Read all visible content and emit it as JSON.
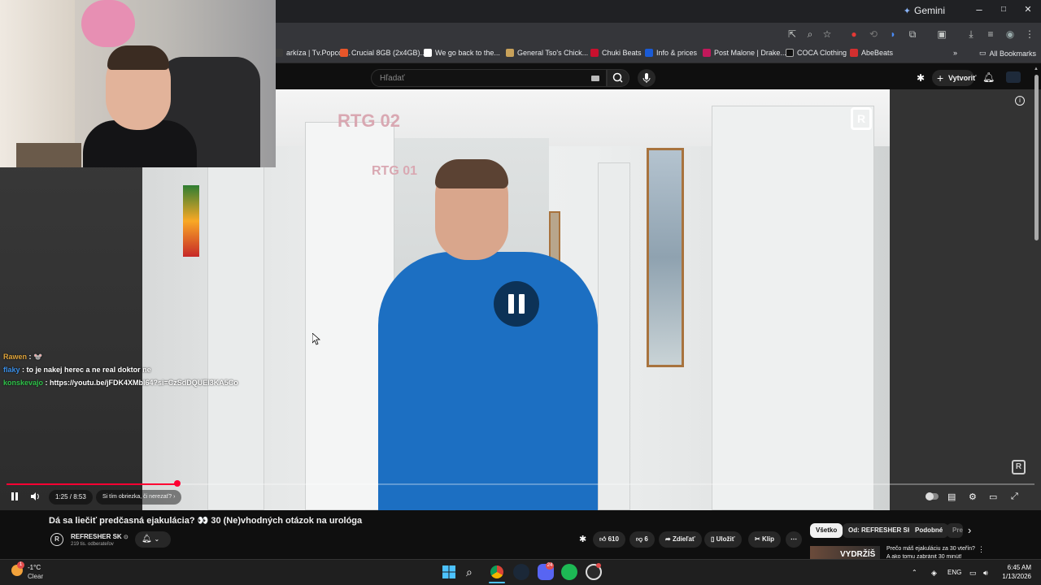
{
  "browser": {
    "gemini_label": "Gemini",
    "window_controls": [
      "–",
      "□",
      "✕"
    ],
    "bookmarks": [
      {
        "label": "arkíza | Tv.Popcor...",
        "color": "#3a3a3a"
      },
      {
        "label": "Crucial 8GB (2x4GB)...",
        "color": "#e8562a"
      },
      {
        "label": "We go back to the...",
        "color": "#ffffff"
      },
      {
        "label": "General Tso's Chick...",
        "color": "#c8a15a"
      },
      {
        "label": "Chuki Beats",
        "color": "#c8102e"
      },
      {
        "label": "Info & prices",
        "color": "#1a5bd6"
      },
      {
        "label": "Post Malone | Drake...",
        "color": "#c2185b"
      },
      {
        "label": "COCA Clothing",
        "color": "#111111"
      },
      {
        "label": "AbeBeats",
        "color": "#d32f2f"
      }
    ],
    "all_bookmarks": "All Bookmarks"
  },
  "masthead": {
    "search_placeholder": "Hľadať",
    "create_label": "Vytvoriť"
  },
  "chat": [
    {
      "user": "Rawen",
      "user_color": "#e0a43a",
      "message": " : 🐭"
    },
    {
      "user": "flaky",
      "user_color": "#3a8ee6",
      "message": " : to je nakej herec a ne real doktor ne"
    },
    {
      "user": "konskevajo",
      "user_color": "#2fc24a",
      "message": " : https://youtu.be/jFDK4XMbl64?si=CzSdDQUEI3KA5Co"
    }
  ],
  "player": {
    "progress": 0.166,
    "time_current": "1:25",
    "time_separator": " / ",
    "time_total": "8:53",
    "chapter": "Si tím obriezka, či nerezať?",
    "chapter_chevron": "›",
    "accent": "#ff0033",
    "video_signs": [
      "RTG 02",
      "RTG 01"
    ]
  },
  "video": {
    "title": "Dá sa liečiť predčasná ejakulácia? 👀 30 (Ne)vhodných otázok na urológa",
    "channel_name": "REFRESHER SK",
    "verified": "⊙",
    "subscribers": "219 tis. odberateľov",
    "likes": "610",
    "dislikes": "6",
    "share": "Zdieľať",
    "save": "Uložiť",
    "clip": "Klip"
  },
  "chips": [
    {
      "label": "Všetko",
      "active": true
    },
    {
      "label": "Od: REFRESHER SK",
      "active": false
    },
    {
      "label": "Podobné",
      "active": false
    },
    {
      "label": "Pre",
      "active": false
    }
  ],
  "recommendation": {
    "thumb_text": "VYDRŽÍŠ",
    "title": "Prečo máš ejakuláciu za 30 vteřín?",
    "subtitle": "A ako tomu zabránit 30 minút!"
  },
  "taskbar": {
    "temperature": "-1°C",
    "condition": "Clear",
    "weather_badge": "1",
    "discord_badge": "24",
    "language": "ENG",
    "time": "6:45 AM",
    "date": "1/13/2026"
  }
}
